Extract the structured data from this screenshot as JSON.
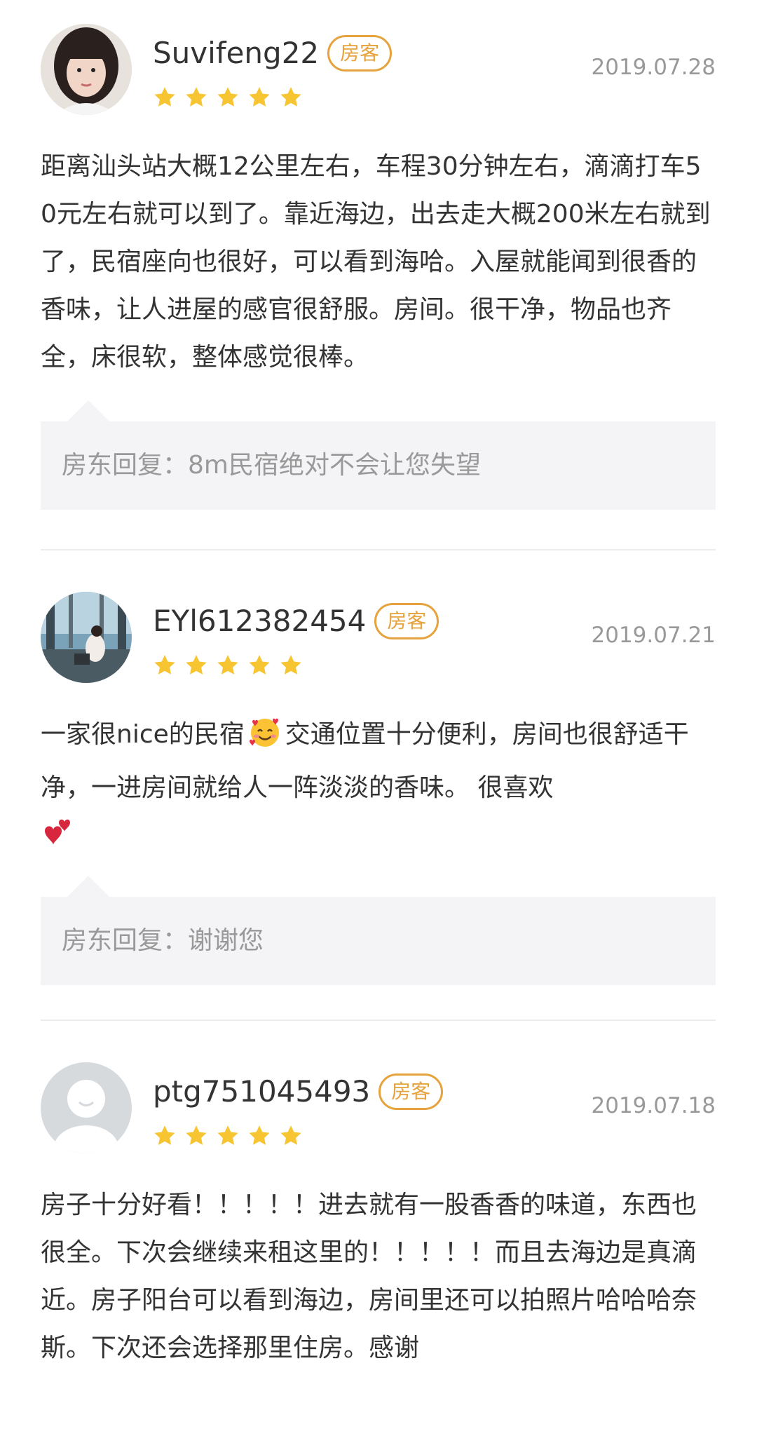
{
  "reviews": [
    {
      "username": "Suvifeng22",
      "badge": "房客",
      "date": "2019.07.28",
      "rating": 5,
      "text": "距离汕头站大概12公里左右，车程30分钟左右，滴滴打车50元左右就可以到了。靠近海边，出去走大概200米左右就到了，民宿座向也很好，可以看到海哈。入屋就能闻到很香的香味，让人进屋的感官很舒服。房间。很干净，物品也齐全，床很软，整体感觉很棒。",
      "reply_label": "房东回复：",
      "reply_text": "8m民宿绝对不会让您失望"
    },
    {
      "username": "EYl612382454",
      "badge": "房客",
      "date": "2019.07.21",
      "rating": 5,
      "text_part1": "一家很nice的民宿",
      "text_part2": "交通位置十分便利，房间也很舒适干净，一进房间就给人一阵淡淡的香味。 很喜欢",
      "reply_label": "房东回复：",
      "reply_text": "谢谢您"
    },
    {
      "username": "ptg751045493",
      "badge": "房客",
      "date": "2019.07.18",
      "rating": 5,
      "text": "房子十分好看！！！！！进去就有一股香香的味道，东西也很全。下次会继续来租这里的！！！！！而且去海边是真滴近。房子阳台可以看到海边，房间里还可以拍照片哈哈哈奈斯。下次还会选择那里住房。感谢"
    }
  ],
  "colors": {
    "badge": "#e6a23c",
    "star": "#f7c531",
    "reply_bg": "#f4f4f6",
    "muted_text": "#999999",
    "body_text": "#333333"
  },
  "icons": {
    "star": "star-icon",
    "emoji1": "smiling-face-with-hearts-emoji",
    "emoji2": "two-hearts-emoji"
  }
}
